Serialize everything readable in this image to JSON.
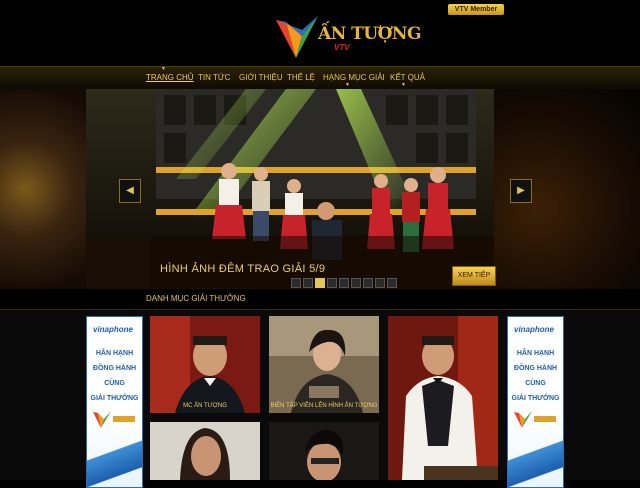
{
  "header": {
    "member_label": "VTV Member",
    "logo_text": "ẤN TƯỢNG",
    "logo_vtv": "VTV"
  },
  "nav": {
    "items": [
      {
        "label": "TRANG CHỦ"
      },
      {
        "label": "TIN TỨC"
      },
      {
        "label": "GIỚI THIỆU"
      },
      {
        "label": "THỂ LỆ"
      },
      {
        "label": "HẠNG MỤC GIẢI"
      },
      {
        "label": "KẾT QUẢ"
      }
    ]
  },
  "slider": {
    "caption": "HÌNH ẢNH ĐÊM TRAO GIẢI 5/9",
    "view_more": "XEM TIẾP",
    "prev_icon": "chevron-left-icon",
    "next_icon": "chevron-right-icon",
    "dot_count": 9,
    "active_dot": 3
  },
  "section": {
    "title": "DANH MỤC GIẢI THƯỞNG"
  },
  "sponsor": {
    "brand": "vinaphone",
    "lines": [
      "HÂN HẠNH",
      "ĐỒNG HÀNH",
      "CÙNG",
      "GIẢI THƯỞNG"
    ]
  },
  "tiles": [
    {
      "caption": "MC ẤN TƯỢNG"
    },
    {
      "caption": "BIÊN TẬP VIÊN LÊN HÌNH ẤN TƯỢNG"
    }
  ],
  "colors": {
    "gold": "#e6c25b",
    "sponsor_blue": "#1d5fae"
  }
}
